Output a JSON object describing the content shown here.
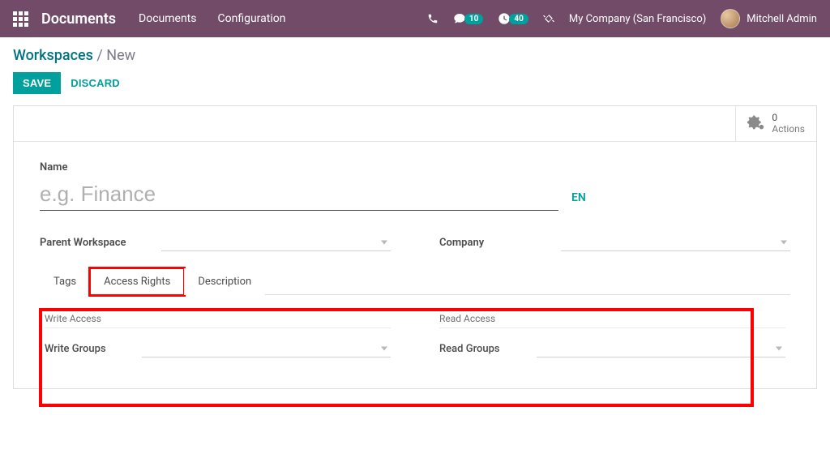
{
  "navbar": {
    "brand": "Documents",
    "menu": [
      "Documents",
      "Configuration"
    ],
    "messages_badge": "10",
    "activities_badge": "40",
    "company": "My Company (San Francisco)",
    "user": "Mitchell Admin"
  },
  "breadcrumb": {
    "root": "Workspaces",
    "sep": " / ",
    "current": "New"
  },
  "buttons": {
    "save": "SAVE",
    "discard": "DISCARD"
  },
  "stat_button": {
    "count": "0",
    "label": "Actions"
  },
  "form": {
    "name_label": "Name",
    "name_placeholder": "e.g. Finance",
    "lang": "EN",
    "parent_label": "Parent Workspace",
    "company_label": "Company"
  },
  "tabs": [
    "Tags",
    "Access Rights",
    "Description"
  ],
  "active_tab": "Access Rights",
  "access": {
    "write_section": "Write Access",
    "write_label": "Write Groups",
    "read_section": "Read Access",
    "read_label": "Read Groups"
  },
  "colors": {
    "primary": "#714b67",
    "teal": "#00a09d",
    "red": "#ff0000"
  }
}
